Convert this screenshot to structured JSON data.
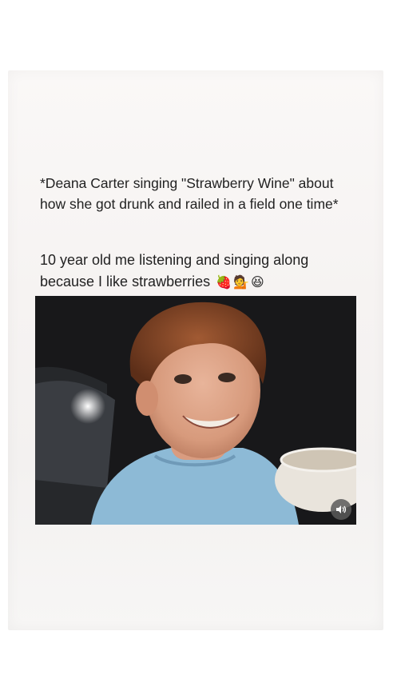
{
  "post": {
    "caption_line1": "*Deana Carter singing \"Strawberry Wine\" about how she got drunk and railed in a field one time*",
    "caption_line2": "10 year old me listening and singing along because I like strawberries",
    "emojis": [
      "strawberry",
      "woman-tipping-hand",
      "grinning-squinting-face"
    ]
  },
  "media": {
    "type": "video",
    "sound_icon": "speaker-volume-icon"
  },
  "colors": {
    "background": "#ffffff",
    "card": "#f6f3f2",
    "text": "#222222"
  }
}
